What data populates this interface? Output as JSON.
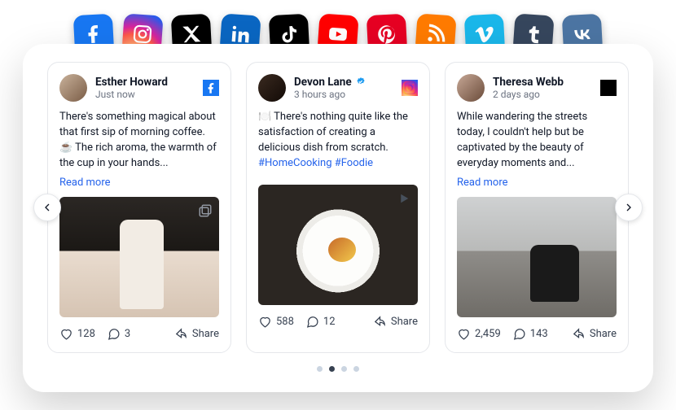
{
  "socialIcons": [
    "facebook",
    "instagram",
    "x",
    "linkedin",
    "tiktok",
    "youtube",
    "pinterest",
    "rss",
    "vimeo",
    "tumblr",
    "vk"
  ],
  "posts": [
    {
      "author": "Esther Howard",
      "time": "Just now",
      "network": "facebook",
      "body": "There's something magical about that first sip of morning coffee. ☕ The rich aroma, the warmth of the cup in your hands...",
      "readmore": "Read more",
      "likes": "128",
      "comments": "3",
      "share": "Share"
    },
    {
      "author": "Devon Lane",
      "verified": true,
      "time": "3 hours ago",
      "network": "instagram",
      "body": "🍽️ There's nothing quite like the satisfaction of creating a delicious dish from scratch. ",
      "hashtags": "#HomeCooking #Foodie",
      "likes": "588",
      "comments": "12",
      "share": "Share"
    },
    {
      "author": "Theresa Webb",
      "time": "2 days ago",
      "network": "x",
      "body": "While wandering the streets today, I couldn't help but be captivated by the beauty of everyday moments and...",
      "readmore": "Read more",
      "likes": "2,459",
      "comments": "143",
      "share": "Share"
    }
  ],
  "pagination": {
    "total": 4,
    "active": 1
  }
}
